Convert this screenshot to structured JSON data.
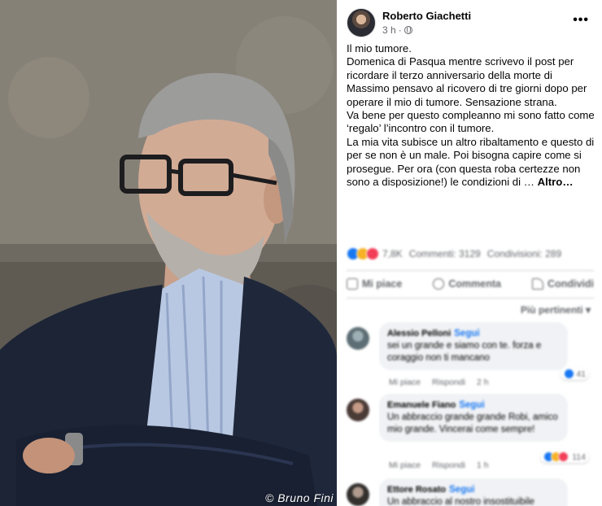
{
  "photo": {
    "credit": "© Bruno Fini"
  },
  "post": {
    "author": "Roberto Giachetti",
    "time": "3 h",
    "privacy_icon": "globe-icon",
    "more_icon": "more-icon",
    "paragraphs": [
      "Il mio tumore.",
      "Domenica di Pasqua mentre scrivevo il post per ricordare il terzo anniversario della morte di Massimo pensavo al ricovero di tre giorni dopo per operare il mio di tumore. Sensazione strana.",
      "Va bene per questo compleanno mi sono fatto come ‘regalo’ l’incontro con il tumore.",
      "La mia vita subisce un altro ribaltamento e questo di per se non è un male. Poi bisogna capire come si prosegue. Per ora (con questa roba certezze non sono a disposizione!) le condizioni di …"
    ],
    "see_more": "Altro…"
  },
  "stats": {
    "reactions_count": "7,8K",
    "comments": "Commenti: 3129",
    "shares": "Condivisioni: 289"
  },
  "actions": {
    "like": "Mi piace",
    "comment": "Commenta",
    "share": "Condividi"
  },
  "sort_label": "Più pertinenti",
  "comments": [
    {
      "name": "Alessio Pelloni",
      "follow": "Segui",
      "text": "sei un grande e siamo con te. forza e coraggio non ti mancano",
      "like": "Mi piace",
      "reply": "Rispondi",
      "time": "2 h",
      "reaction_count": "41"
    },
    {
      "name": "Emanuele Fiano",
      "follow": "Segui",
      "text": "Un abbraccio grande grande Robi, amico mio grande. Vincerai come sempre!",
      "like": "Mi piace",
      "reply": "Rispondi",
      "time": "1 h",
      "reaction_count": "114"
    },
    {
      "name": "Ettore Rosato",
      "follow": "Segui",
      "text": "Un abbraccio al nostro insostituibile"
    }
  ],
  "colors": {
    "link": "#1877f2",
    "secondary_text": "#65676b",
    "bubble": "#f0f2f5"
  }
}
